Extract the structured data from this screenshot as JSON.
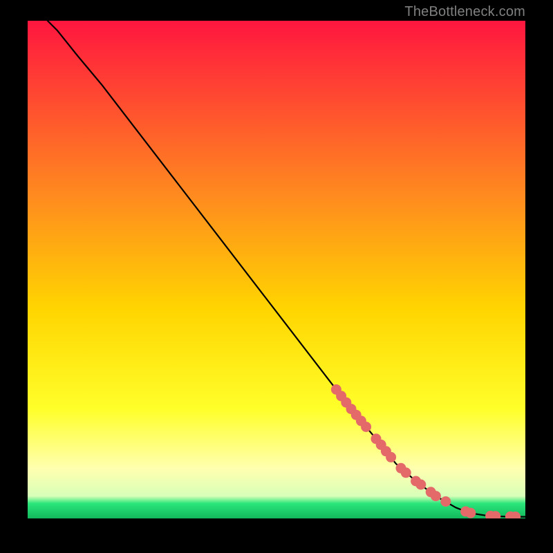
{
  "attribution": "TheBottleneck.com",
  "colors": {
    "gradient_top": "#ff163f",
    "gradient_mid1": "#ff8a1f",
    "gradient_mid2": "#ffd500",
    "gradient_mid3": "#ffff2a",
    "gradient_mid4": "#ffffb0",
    "gradient_green": "#2ae67a",
    "curve": "#000000",
    "marker": "#e46a6a",
    "frame": "#000000"
  },
  "chart_data": {
    "type": "line",
    "title": "",
    "xlabel": "",
    "ylabel": "",
    "xlim": [
      0,
      100
    ],
    "ylim": [
      0,
      100
    ],
    "series": [
      {
        "name": "curve",
        "x": [
          4,
          6,
          8,
          10,
          15,
          20,
          30,
          40,
          50,
          60,
          65,
          70,
          74,
          78,
          82,
          86,
          88,
          90,
          92,
          94,
          96,
          98,
          100
        ],
        "y": [
          100,
          98,
          95.5,
          93,
          87,
          80.5,
          67.5,
          54.5,
          41.5,
          28.5,
          22,
          16,
          11,
          7.5,
          4.5,
          2.2,
          1.4,
          0.9,
          0.6,
          0.45,
          0.38,
          0.35,
          0.33
        ]
      }
    ],
    "markers": {
      "name": "highlighted-segments",
      "points": [
        {
          "x": 62,
          "y": 25.9
        },
        {
          "x": 63,
          "y": 24.6
        },
        {
          "x": 64,
          "y": 23.3
        },
        {
          "x": 65,
          "y": 22.0
        },
        {
          "x": 66,
          "y": 20.8
        },
        {
          "x": 67,
          "y": 19.6
        },
        {
          "x": 68,
          "y": 18.4
        },
        {
          "x": 70,
          "y": 16.0
        },
        {
          "x": 71,
          "y": 14.8
        },
        {
          "x": 72,
          "y": 13.5
        },
        {
          "x": 73,
          "y": 12.3
        },
        {
          "x": 75,
          "y": 10.1
        },
        {
          "x": 76,
          "y": 9.2
        },
        {
          "x": 78,
          "y": 7.5
        },
        {
          "x": 79,
          "y": 6.8
        },
        {
          "x": 81,
          "y": 5.3
        },
        {
          "x": 82,
          "y": 4.5
        },
        {
          "x": 84,
          "y": 3.4
        },
        {
          "x": 88,
          "y": 1.4
        },
        {
          "x": 89,
          "y": 1.1
        },
        {
          "x": 93,
          "y": 0.5
        },
        {
          "x": 94,
          "y": 0.45
        },
        {
          "x": 97,
          "y": 0.37
        },
        {
          "x": 98,
          "y": 0.35
        }
      ]
    }
  }
}
